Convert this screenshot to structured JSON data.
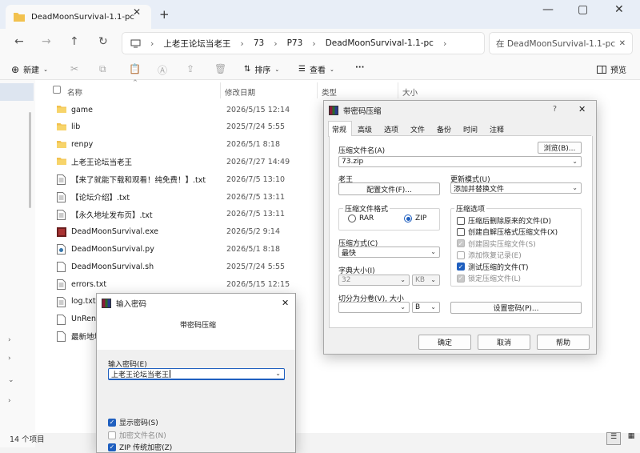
{
  "explorer": {
    "tab_title": "DeadMoonSurvival-1.1-pc",
    "breadcrumbs": [
      "上老王论坛当老王",
      "73",
      "P73",
      "DeadMoonSurvival-1.1-pc"
    ],
    "search_placeholder": "在 DeadMoonSurvival-1.1-pc",
    "toolbar": {
      "new": "新建",
      "sort": "排序",
      "view": "查看",
      "more": "···",
      "preview": "预览"
    },
    "columns": {
      "name": "名称",
      "date": "修改日期",
      "type": "类型",
      "size": "大小"
    },
    "files": [
      {
        "name": "game",
        "date": "2026/5/15 12:14",
        "icon": "folder-icon"
      },
      {
        "name": "lib",
        "date": "2025/7/24 5:55",
        "icon": "folder-icon"
      },
      {
        "name": "renpy",
        "date": "2026/5/1 8:18",
        "icon": "folder-icon"
      },
      {
        "name": "上老王论坛当老王",
        "date": "2026/7/27 14:49",
        "icon": "folder-icon"
      },
      {
        "name": "【来了就能下载和观看！纯免费！】.txt",
        "date": "2026/7/5 13:10",
        "icon": "text-file-icon"
      },
      {
        "name": "【论坛介绍】.txt",
        "date": "2026/7/5 13:11",
        "icon": "text-file-icon"
      },
      {
        "name": "【永久地址发布页】.txt",
        "date": "2026/7/5 13:11",
        "icon": "text-file-icon"
      },
      {
        "name": "DeadMoonSurvival.exe",
        "date": "2026/5/2 9:14",
        "icon": "exe-icon"
      },
      {
        "name": "DeadMoonSurvival.py",
        "date": "2026/5/1 8:18",
        "icon": "python-file-icon"
      },
      {
        "name": "DeadMoonSurvival.sh",
        "date": "2025/7/24 5:55",
        "icon": "file-icon"
      },
      {
        "name": "errors.txt",
        "date": "2026/5/15 12:15",
        "icon": "text-file-icon"
      },
      {
        "name": "log.txt",
        "date": "",
        "icon": "text-file-icon"
      },
      {
        "name": "UnRen-",
        "date": "",
        "icon": "file-icon"
      },
      {
        "name": "最新地址",
        "date": "",
        "icon": "file-icon"
      }
    ],
    "status": "14 个项目"
  },
  "archive_dialog": {
    "title": "带密码压缩",
    "help": "?",
    "tabs": [
      "常规",
      "高级",
      "选项",
      "文件",
      "备份",
      "时间",
      "注释"
    ],
    "archive_name_label": "压缩文件名(A)",
    "browse": "浏览(B)...",
    "archive_name": "73.zip",
    "profile_label": "老王",
    "profiles_button": "配置文件(F)...",
    "update_mode_label": "更新模式(U)",
    "update_mode": "添加并替换文件",
    "format_label": "压缩文件格式",
    "format_rar": "RAR",
    "format_zip": "ZIP",
    "options_label": "压缩选项",
    "options": [
      {
        "label": "压缩后删除原来的文件(D)",
        "state": "off"
      },
      {
        "label": "创建自解压格式压缩文件(X)",
        "state": "off"
      },
      {
        "label": "创建固实压缩文件(S)",
        "state": "disabled-on"
      },
      {
        "label": "添加恢复记录(E)",
        "state": "disabled-off"
      },
      {
        "label": "测试压缩的文件(T)",
        "state": "on"
      },
      {
        "label": "锁定压缩文件(L)",
        "state": "disabled-on"
      }
    ],
    "method_label": "压缩方式(C)",
    "method": "最快",
    "dict_label": "字典大小(I)",
    "dict_size": "32",
    "dict_unit": "KB",
    "split_label": "切分为分卷(V), 大小",
    "split_unit": "B",
    "set_password": "设置密码(P)...",
    "ok": "确定",
    "cancel": "取消",
    "help_button": "帮助"
  },
  "password_dialog": {
    "title": "输入密码",
    "subtitle": "带密码压缩",
    "enter_label": "输入密码(E)",
    "password_value": "上老王论坛当老王",
    "show_password": "显示密码(S)",
    "encrypt_names": "加密文件名(N)",
    "zip_legacy": "ZIP 传统加密(Z)"
  }
}
